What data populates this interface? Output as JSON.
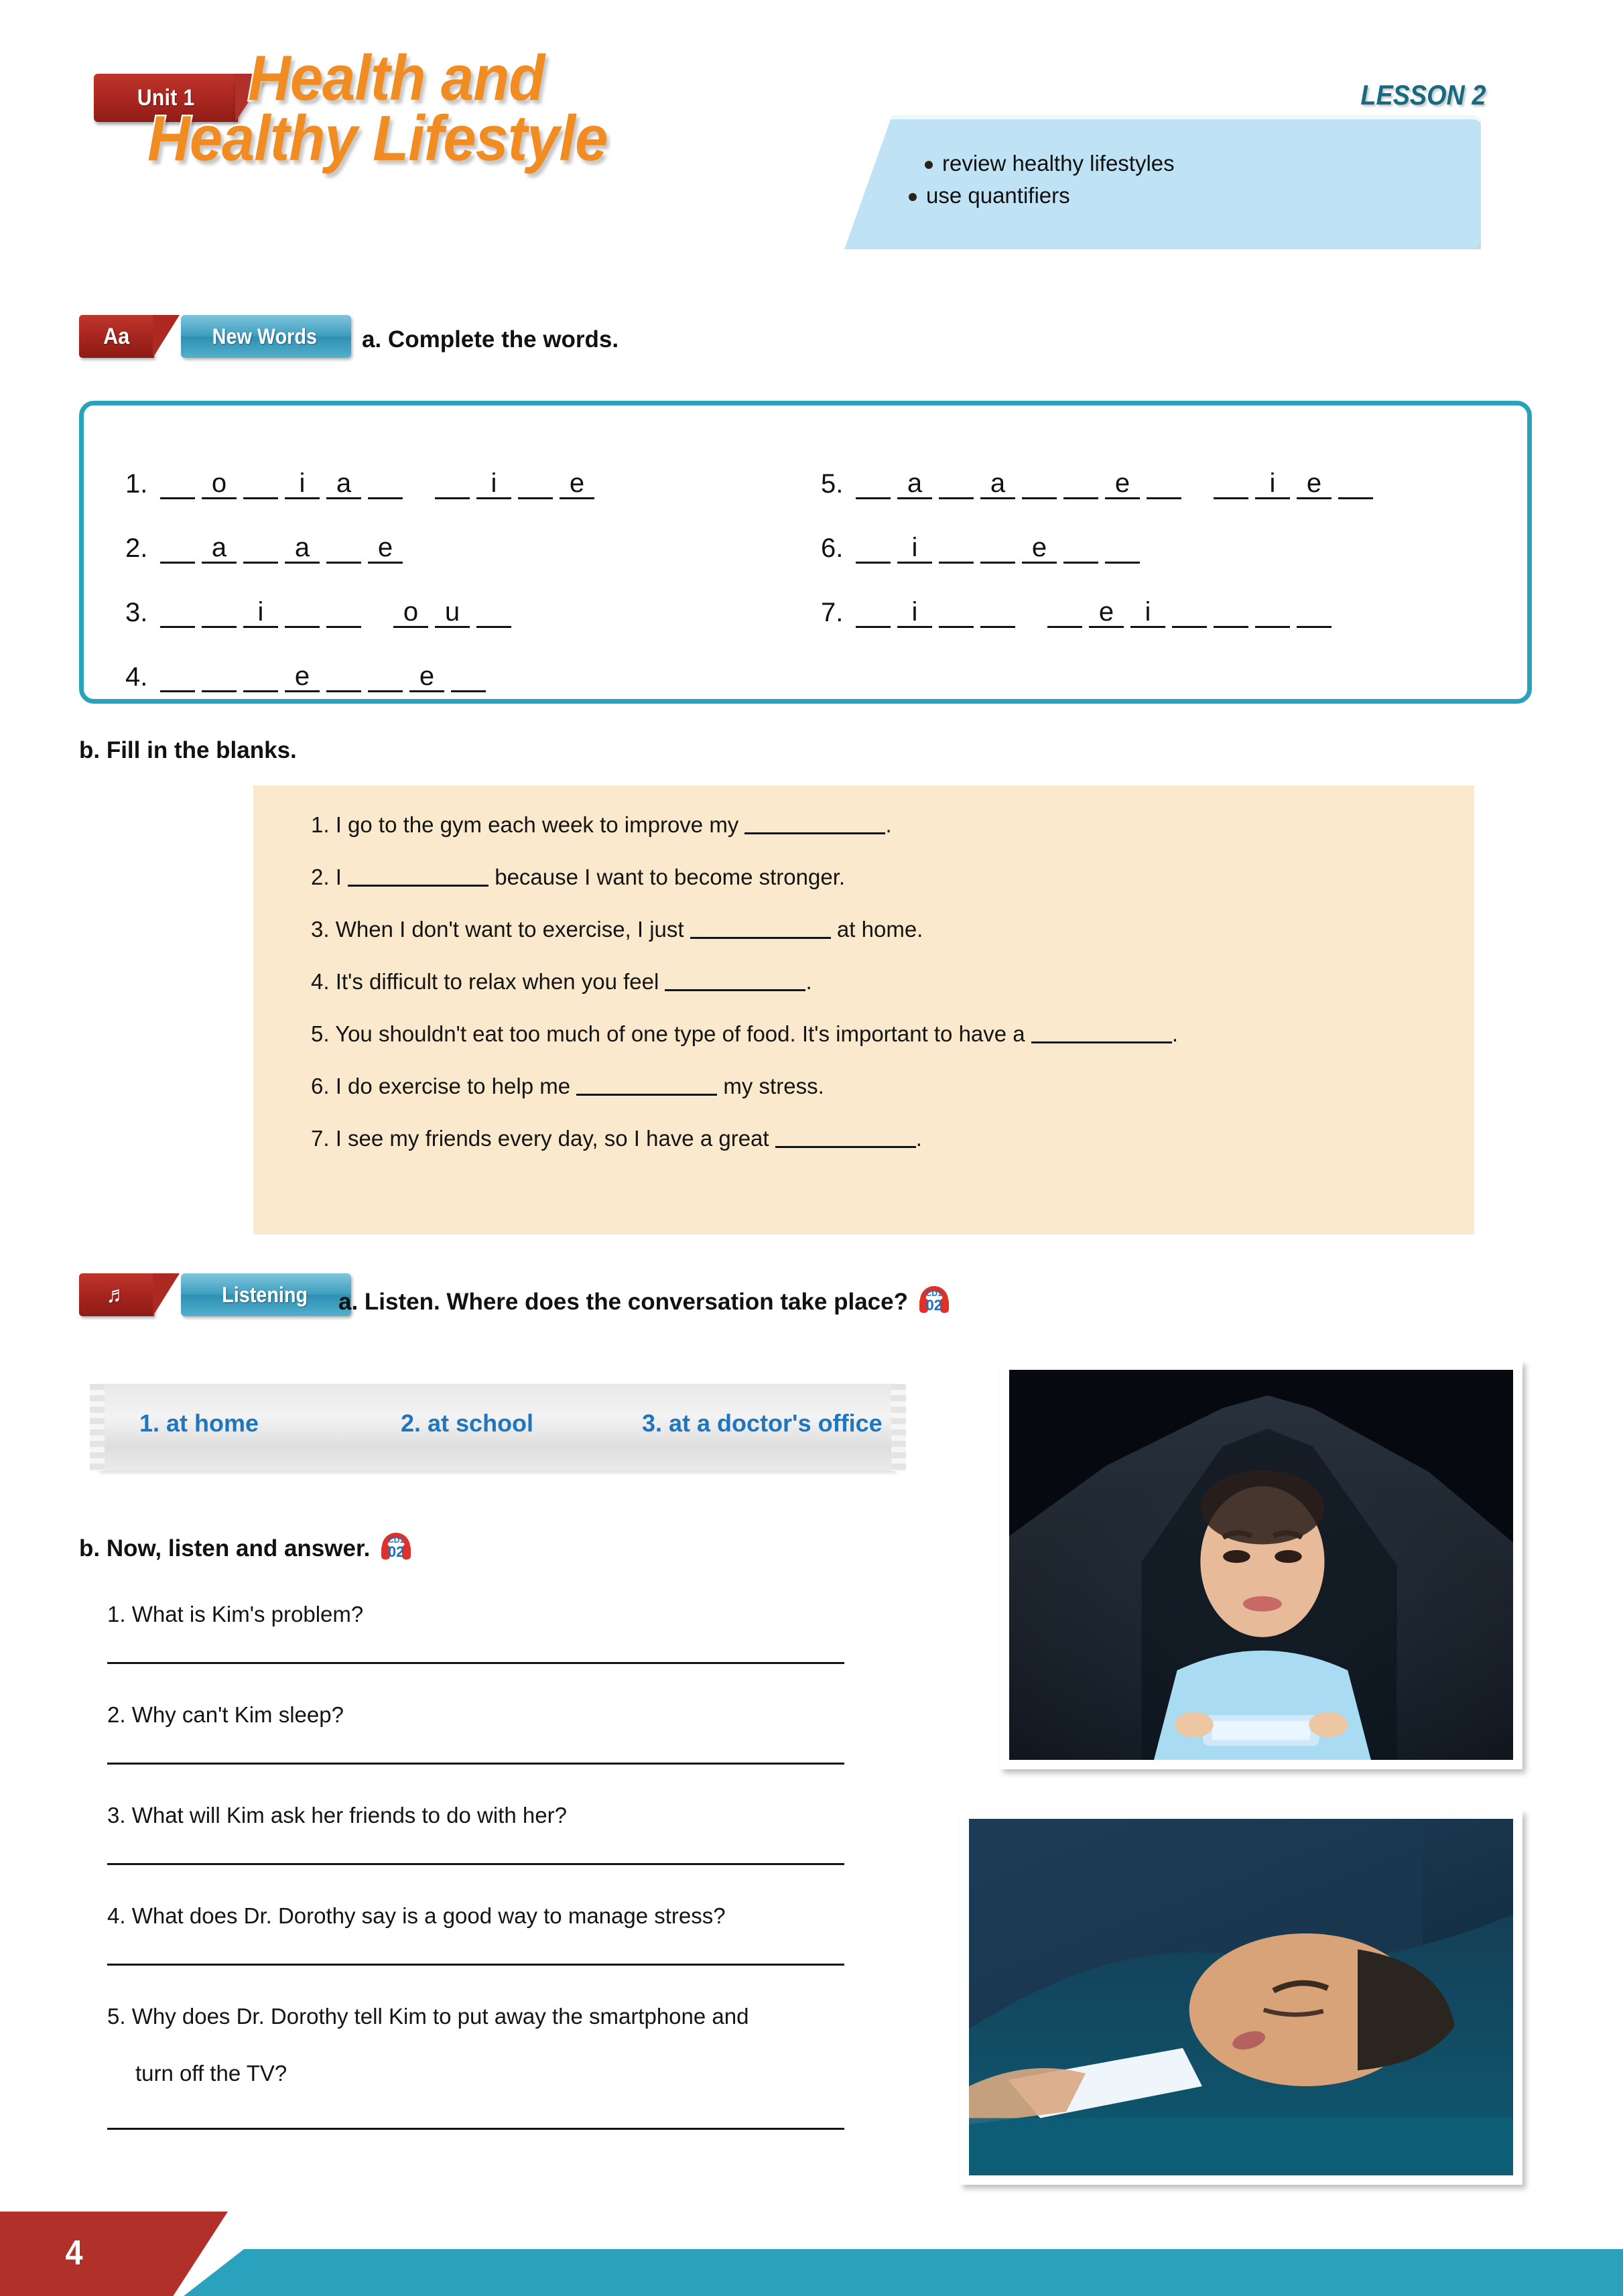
{
  "header": {
    "unit_badge": "Unit 1",
    "title_line1": "Health and",
    "title_line2": "Healthy Lifestyle",
    "lesson_tag": "LESSON 2",
    "goals": [
      "review healthy lifestyles",
      "use quantifiers"
    ]
  },
  "new_words": {
    "tag_icon": "Aa",
    "tag_label": "New Words",
    "instruction": "a. Complete the words.",
    "items": [
      {
        "num": "1.",
        "groups": [
          [
            "",
            "o",
            "",
            "i",
            "a",
            ""
          ],
          [
            "",
            "i",
            "",
            "e"
          ]
        ]
      },
      {
        "num": "2.",
        "groups": [
          [
            "",
            "a",
            "",
            "a",
            "",
            "e"
          ]
        ]
      },
      {
        "num": "3.",
        "groups": [
          [
            "",
            "",
            "i",
            "",
            ""
          ],
          [
            "o",
            "u",
            ""
          ]
        ]
      },
      {
        "num": "4.",
        "groups": [
          [
            "",
            "",
            "",
            "e",
            "",
            "",
            "e",
            ""
          ]
        ]
      },
      {
        "num": "5.",
        "groups": [
          [
            "",
            "a",
            "",
            "a",
            "",
            "",
            "e",
            ""
          ],
          [
            "",
            "i",
            "e",
            ""
          ]
        ]
      },
      {
        "num": "6.",
        "groups": [
          [
            "",
            "i",
            "",
            "",
            "e",
            "",
            ""
          ]
        ]
      },
      {
        "num": "7.",
        "groups": [
          [
            "",
            "i",
            "",
            ""
          ],
          [
            "",
            "e",
            "i",
            "",
            "",
            "",
            ""
          ]
        ]
      }
    ]
  },
  "fill_blanks": {
    "heading": "b. Fill in the blanks.",
    "items": [
      {
        "num": "1.",
        "before": "I go to the gym each week to improve my",
        "after": "."
      },
      {
        "num": "2.",
        "before": "I",
        "after": "because I want to become stronger."
      },
      {
        "num": "3.",
        "before": "When I don't want to exercise, I just",
        "after": "at home."
      },
      {
        "num": "4.",
        "before": "It's difficult to relax when you feel",
        "after": "."
      },
      {
        "num": "5.",
        "before": "You shouldn't eat too much of one type of food. It's important to have a",
        "after": "."
      },
      {
        "num": "6.",
        "before": "I do exercise to help me",
        "after": "my stress."
      },
      {
        "num": "7.",
        "before": "I see my friends every day, so I have a great",
        "after": "."
      }
    ]
  },
  "listening": {
    "tag_icon": "headphones-icon",
    "tag_label": "Listening",
    "instruction_a": "a. Listen. Where does the conversation take place?",
    "cd_label_top": "CD1",
    "cd_label_bottom": "02",
    "options": [
      "1. at home",
      "2. at school",
      "3. at a doctor's office"
    ],
    "instruction_b": "b. Now, listen and answer.",
    "questions": [
      "1. What is Kim's problem?",
      "2. Why can't Kim sleep?",
      "3. What will Kim ask her friends to do with her?",
      "4. What does Dr. Dorothy say is a good way to manage stress?",
      "5. Why does Dr. Dorothy tell Kim to put away the smartphone and",
      "turn off the TV?"
    ],
    "photo1_alt": "girl-under-blanket-using-smartphone",
    "photo2_alt": "person-lying-in-bed-with-glowing-phone"
  },
  "footer": {
    "page_number": "4"
  },
  "colors": {
    "orange_title": "#F08C22",
    "red_badge": "#b2302a",
    "teal": "#2aa2bd",
    "light_blue_banner": "#bfe3f5",
    "cream_box": "#fbe9cd",
    "option_blue": "#1f76bc",
    "lesson_tag_teal": "#166b82"
  }
}
